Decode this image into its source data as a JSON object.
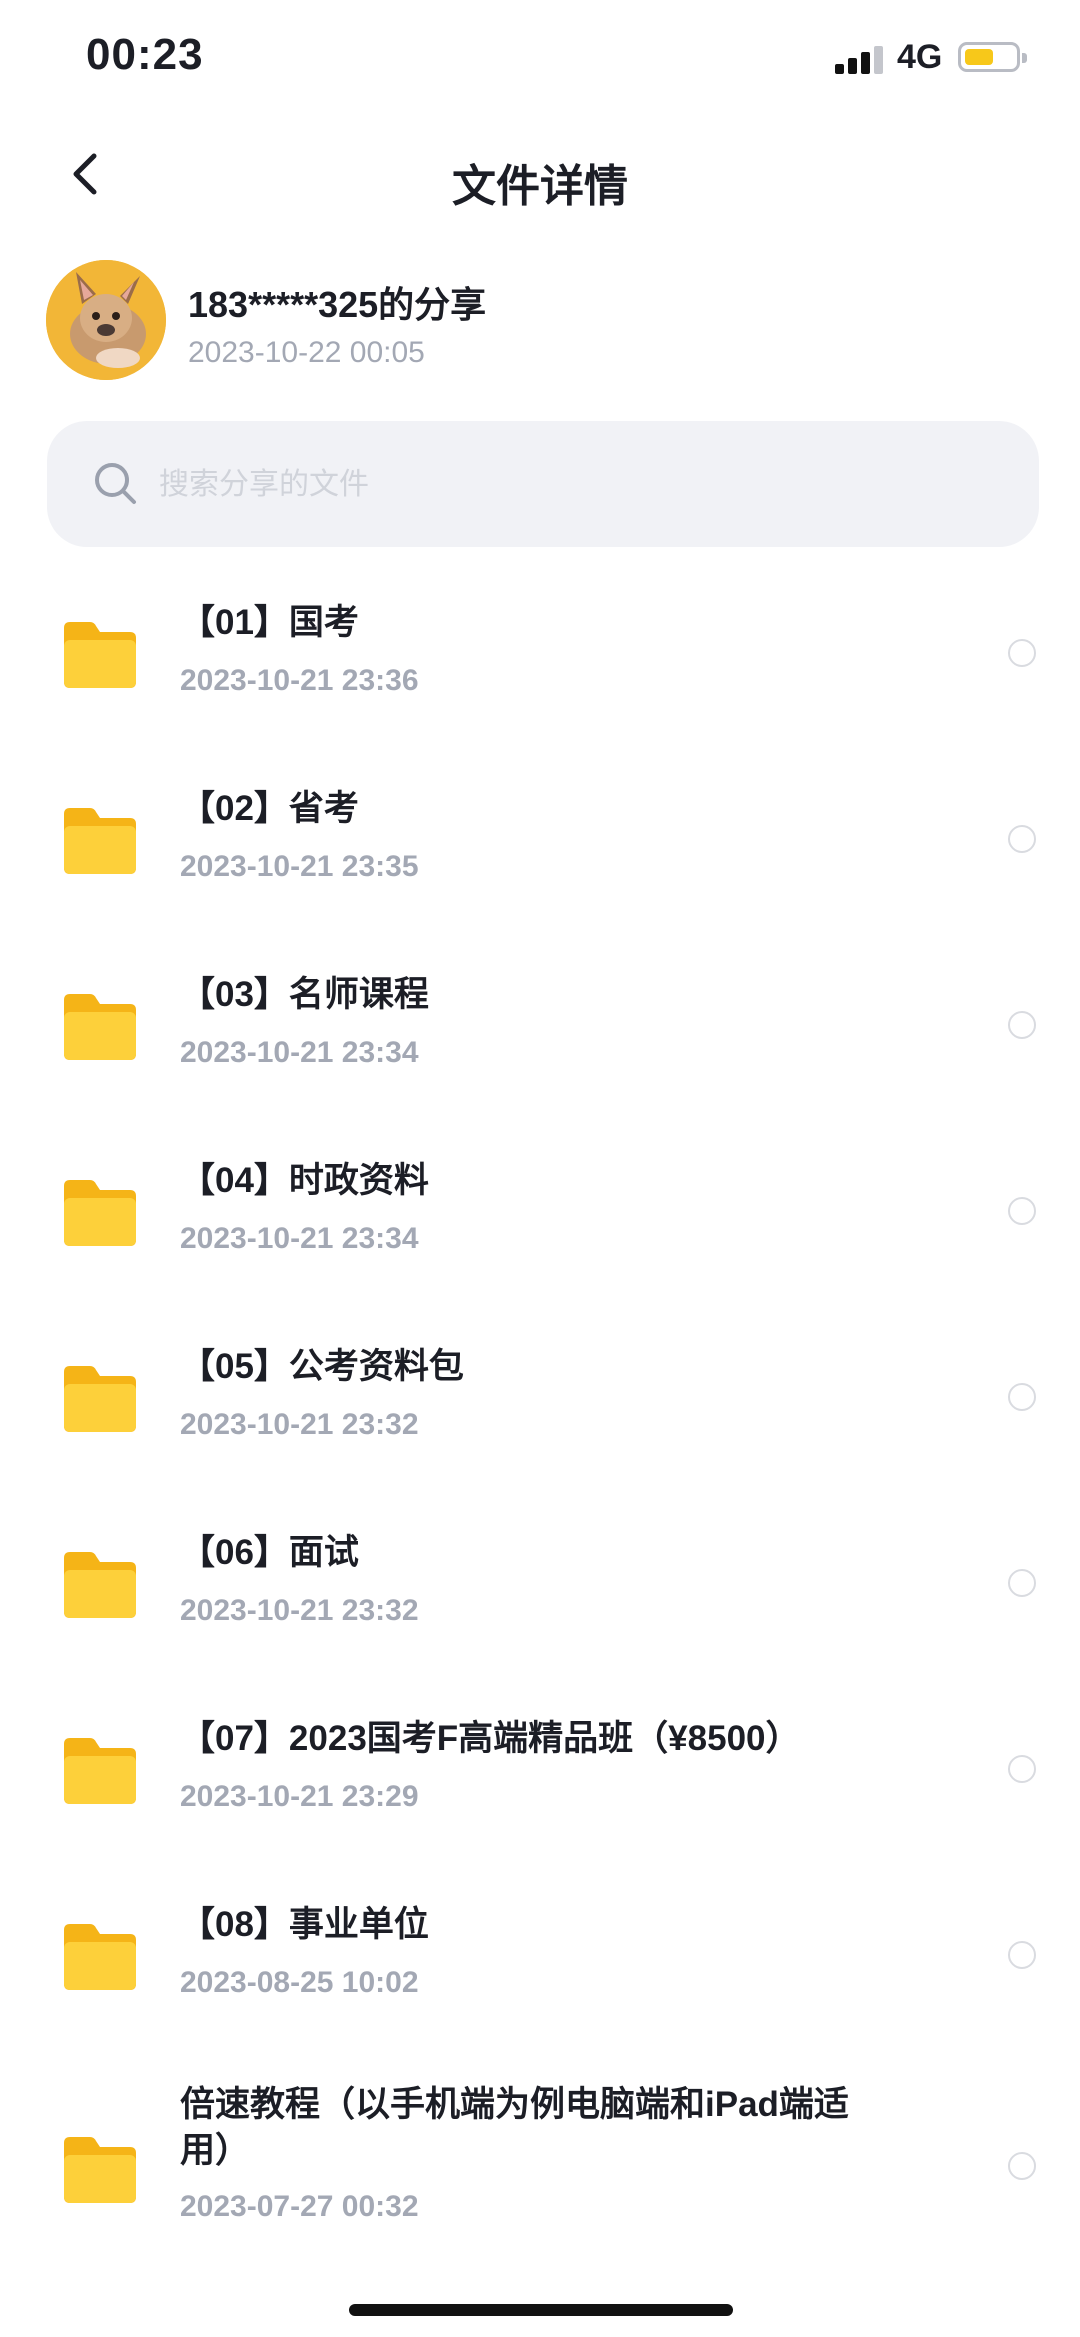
{
  "status_bar": {
    "time": "00:23",
    "network": "4G"
  },
  "nav": {
    "title": "文件详情"
  },
  "share": {
    "title": "183*****325的分享",
    "timestamp": "2023-10-22 00:05"
  },
  "search": {
    "placeholder": "搜索分享的文件"
  },
  "files": [
    {
      "name": "【01】国考",
      "date": "2023-10-21 23:36"
    },
    {
      "name": "【02】省考",
      "date": "2023-10-21 23:35"
    },
    {
      "name": "【03】名师课程",
      "date": "2023-10-21 23:34"
    },
    {
      "name": "【04】时政资料",
      "date": "2023-10-21 23:34"
    },
    {
      "name": "【05】公考资料包",
      "date": "2023-10-21 23:32"
    },
    {
      "name": "【06】面试",
      "date": "2023-10-21 23:32"
    },
    {
      "name": "【07】2023国考F高端精品班（¥8500）",
      "date": "2023-10-21 23:29"
    },
    {
      "name": "【08】事业单位",
      "date": "2023-08-25 10:02"
    },
    {
      "name": "倍速教程（以手机端为例电脑端和iPad端适用）",
      "date": "2023-07-27 00:32"
    }
  ],
  "colors": {
    "folder": "#fbc828",
    "accent_battery": "#f7c81a",
    "muted_text": "#a3a8b4",
    "search_bg": "#f1f2f6"
  },
  "icons": {
    "back": "chevron-left-icon",
    "search": "search-icon",
    "folder": "folder-icon",
    "select": "radio-circle-icon"
  }
}
